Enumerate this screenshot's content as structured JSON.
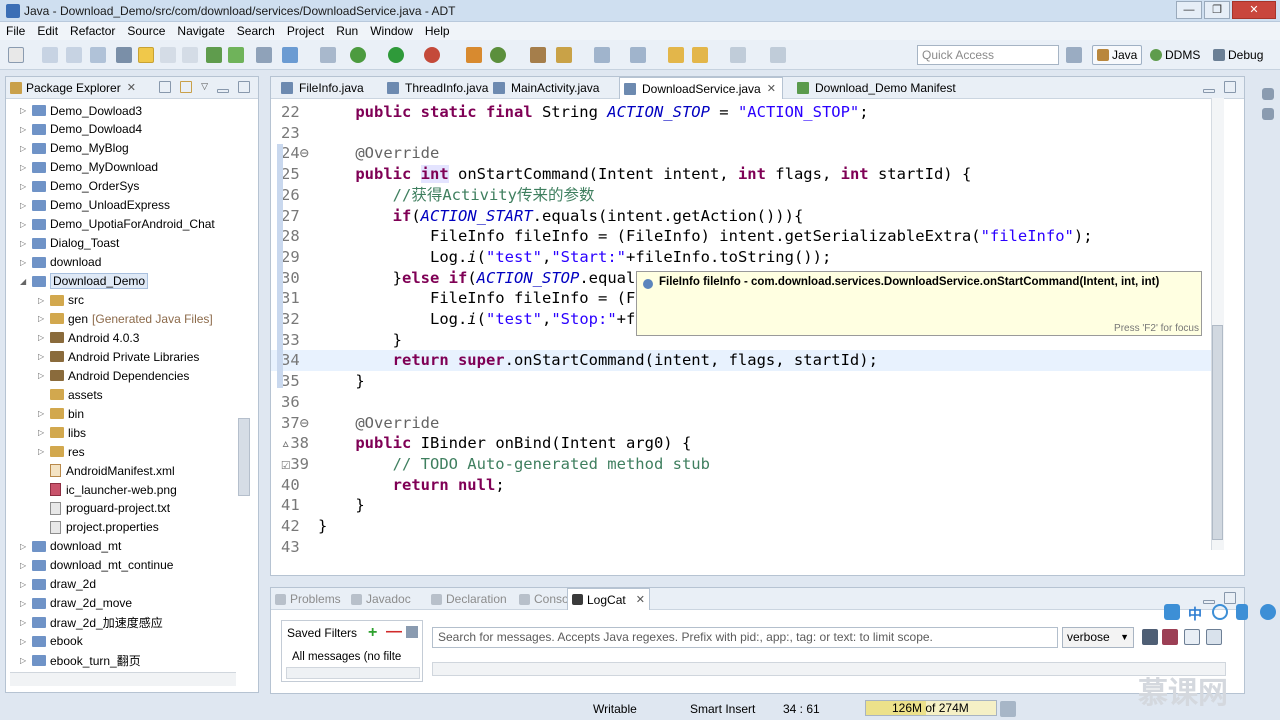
{
  "window": {
    "title": "Java - Download_Demo/src/com/download/services/DownloadService.java - ADT"
  },
  "menu": [
    "File",
    "Edit",
    "Refactor",
    "Source",
    "Navigate",
    "Search",
    "Project",
    "Run",
    "Window",
    "Help"
  ],
  "toolbar": {
    "quick_access_placeholder": "Quick Access"
  },
  "perspectives": [
    {
      "label": "Java",
      "active": true
    },
    {
      "label": "DDMS",
      "active": false
    },
    {
      "label": "Debug",
      "active": false
    }
  ],
  "package_explorer": {
    "title": "Package Explorer",
    "items": [
      {
        "label": "Demo_Dowload3",
        "type": "project",
        "level": 0
      },
      {
        "label": "Demo_Dowload4",
        "type": "project",
        "level": 0
      },
      {
        "label": "Demo_MyBlog",
        "type": "project",
        "level": 0
      },
      {
        "label": "Demo_MyDownload",
        "type": "project",
        "level": 0
      },
      {
        "label": "Demo_OrderSys",
        "type": "project",
        "level": 0
      },
      {
        "label": "Demo_UnloadExpress",
        "type": "project",
        "level": 0
      },
      {
        "label": "Demo_UpotiaForAndroid_Chat",
        "type": "project",
        "level": 0
      },
      {
        "label": "Dialog_Toast",
        "type": "project",
        "level": 0
      },
      {
        "label": "download",
        "type": "project",
        "level": 0
      },
      {
        "label": "Download_Demo",
        "type": "project",
        "level": 0,
        "expanded": true,
        "selected": true
      },
      {
        "label": "src",
        "type": "src",
        "level": 1
      },
      {
        "label": "gen",
        "suffix": "[Generated Java Files]",
        "type": "src",
        "level": 1
      },
      {
        "label": "Android 4.0.3",
        "type": "lib",
        "level": 1
      },
      {
        "label": "Android Private Libraries",
        "type": "lib",
        "level": 1
      },
      {
        "label": "Android Dependencies",
        "type": "lib",
        "level": 1
      },
      {
        "label": "assets",
        "type": "folder",
        "level": 1,
        "noarrow": true
      },
      {
        "label": "bin",
        "type": "folder",
        "level": 1
      },
      {
        "label": "libs",
        "type": "folder",
        "level": 1
      },
      {
        "label": "res",
        "type": "folder",
        "level": 1
      },
      {
        "label": "AndroidManifest.xml",
        "type": "xml",
        "level": 1,
        "noarrow": true
      },
      {
        "label": "ic_launcher-web.png",
        "type": "png",
        "level": 1,
        "noarrow": true
      },
      {
        "label": "proguard-project.txt",
        "type": "file",
        "level": 1,
        "noarrow": true
      },
      {
        "label": "project.properties",
        "type": "file",
        "level": 1,
        "noarrow": true
      },
      {
        "label": "download_mt",
        "type": "project",
        "level": 0
      },
      {
        "label": "download_mt_continue",
        "type": "project",
        "level": 0
      },
      {
        "label": "draw_2d",
        "type": "project",
        "level": 0
      },
      {
        "label": "draw_2d_move",
        "type": "project",
        "level": 0
      },
      {
        "label": "draw_2d_加速度感应",
        "type": "project",
        "level": 0
      },
      {
        "label": "ebook",
        "type": "project",
        "level": 0
      },
      {
        "label": "ebook_turn_翻页",
        "type": "project",
        "level": 0
      }
    ]
  },
  "editor": {
    "tabs": [
      {
        "label": "FileInfo.java",
        "icon": "java"
      },
      {
        "label": "ThreadInfo.java",
        "icon": "java"
      },
      {
        "label": "MainActivity.java",
        "icon": "java"
      },
      {
        "label": "DownloadService.java",
        "icon": "java",
        "active": true
      },
      {
        "label": "Download_Demo Manifest",
        "icon": "manifest"
      }
    ],
    "lines": [
      {
        "n": "22",
        "html": "    <span class=\"kw\">public static final</span> String <span class=\"it\">ACTION_STOP</span> = <span class=\"st\">\"ACTION_STOP\"</span>;"
      },
      {
        "n": "23",
        "html": ""
      },
      {
        "n": "24⊖",
        "html": "    <span class=\"an\">@Override</span>"
      },
      {
        "n": "25",
        "html": "    <span class=\"kw\">public</span> <span class=\"kw hl\">int</span> onStartCommand(Intent intent, <span class=\"kw\">int</span> flags, <span class=\"kw\">int</span> startId) {"
      },
      {
        "n": "26",
        "html": "        <span class=\"cm\">//获得Activity传来的参数</span>"
      },
      {
        "n": "27",
        "html": "        <span class=\"kw\">if</span>(<span class=\"it\">ACTION_START</span>.equals(intent.getAction())){"
      },
      {
        "n": "28",
        "html": "            FileInfo fileInfo = (FileInfo) intent.getSerializableExtra(<span class=\"st\">\"fileInfo\"</span>);"
      },
      {
        "n": "29",
        "html": "            Log.<span class=\"fn\">i</span>(<span class=\"st\">\"test\"</span>,<span class=\"st\">\"Start:\"</span>+fileInfo.toString());"
      },
      {
        "n": "30",
        "html": "        }<span class=\"kw\">else if</span>(<span class=\"it\">ACTION_STOP</span>.equals(intent.getAction())){"
      },
      {
        "n": "31",
        "html": "            FileInfo fileInfo = (FileInfo) intent.getSerializableExtra(<span class=\"st\">\"fileInfo\"</span>);"
      },
      {
        "n": "32",
        "html": "            Log.<span class=\"fn\">i</span>(<span class=\"st\">\"test\"</span>,<span class=\"st\">\"Stop:\"</span>+fileInfo.toString());"
      },
      {
        "n": "33",
        "html": "        }"
      },
      {
        "n": "34",
        "html": "        <span class=\"kw\">return super</span>.onStartCommand(intent, flags, startId);",
        "current": true
      },
      {
        "n": "35",
        "html": "    }"
      },
      {
        "n": "36",
        "html": ""
      },
      {
        "n": "37⊖",
        "html": "    <span class=\"an\">@Override</span>"
      },
      {
        "n": "▵38",
        "html": "    <span class=\"kw\">public</span> IBinder onBind(Intent arg0) {"
      },
      {
        "n": "☑39",
        "html": "        <span class=\"cm\">// TODO Auto-generated method stub</span>"
      },
      {
        "n": "40",
        "html": "        <span class=\"kw\">return null</span>;"
      },
      {
        "n": "41",
        "html": "    }"
      },
      {
        "n": "42",
        "html": "}"
      },
      {
        "n": "43",
        "html": ""
      }
    ]
  },
  "tooltip": {
    "signature": "FileInfo fileInfo - com.download.services.DownloadService.onStartCommand(Intent, int, int)",
    "hint": "Press 'F2' for focus"
  },
  "bottom_panel": {
    "tabs": [
      {
        "label": "Problems"
      },
      {
        "label": "Javadoc"
      },
      {
        "label": "Declaration"
      },
      {
        "label": "Console"
      },
      {
        "label": "LogCat",
        "active": true
      }
    ],
    "saved_filters_label": "Saved Filters",
    "saved_filter_item": "All messages (no filte",
    "search_placeholder": "Search for messages. Accepts Java regexes. Prefix with pid:, app:, tag: or text: to limit scope.",
    "level_select": "verbose"
  },
  "status": {
    "writable": "Writable",
    "insert_mode": "Smart Insert",
    "position": "34 : 61",
    "heap_used": "126M",
    "heap_total": "of 274M",
    "heap_fraction": 0.46
  },
  "watermark": "慕课网"
}
